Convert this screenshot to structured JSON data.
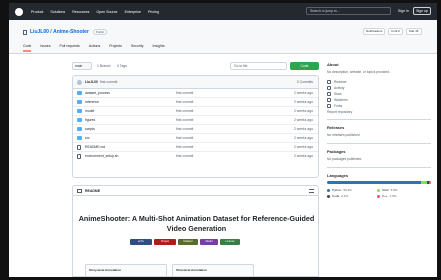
{
  "nav": {
    "items": [
      "Product",
      "Solutions",
      "Resources",
      "Open Source",
      "Enterprise",
      "Pricing"
    ],
    "search_placeholder": "Search or jump to...",
    "signin": "Sign in",
    "signup": "Sign up"
  },
  "repo": {
    "owner": "LiuJL00",
    "name": "Anime-Shooter",
    "visibility": "Public",
    "buttons": [
      "Notifications",
      "Fork 0",
      "Star 45"
    ],
    "tabs": [
      "Code",
      "Issues",
      "Pull requests",
      "Actions",
      "Projects",
      "Security",
      "Insights"
    ]
  },
  "controls": {
    "branch": "main",
    "branches": "1 Branch",
    "tags": "0 Tags",
    "goto": "Go to file",
    "code": "Code"
  },
  "commit": {
    "user": "LiuJL00",
    "message": "first commit",
    "count": "3 Commits"
  },
  "files": [
    {
      "name": "dataset_process",
      "type": "dir",
      "msg": "first commit",
      "time": "2 weeks ago"
    },
    {
      "name": "inference",
      "type": "dir",
      "msg": "first commit",
      "time": "2 weeks ago"
    },
    {
      "name": "model",
      "type": "dir",
      "msg": "first commit",
      "time": "2 weeks ago"
    },
    {
      "name": "figures",
      "type": "dir",
      "msg": "first commit",
      "time": "2 weeks ago"
    },
    {
      "name": "scripts",
      "type": "dir",
      "msg": "first commit",
      "time": "2 weeks ago"
    },
    {
      "name": "src",
      "type": "dir",
      "msg": "first commit",
      "time": "2 weeks ago"
    },
    {
      "name": "README.md",
      "type": "file",
      "msg": "first commit",
      "time": "2 weeks ago"
    },
    {
      "name": "environment_setup.sh",
      "type": "file",
      "msg": "first commit",
      "time": "2 weeks ago"
    }
  ],
  "readme": {
    "label": "README",
    "title": "AnimeShooter: A Multi-Shot Animation Dataset for Reference-Guided Video Generation",
    "badges": [
      {
        "text": "arXiv",
        "color": "#2f4f7f"
      },
      {
        "text": "Project",
        "color": "#b31b1b"
      },
      {
        "text": "Dataset",
        "color": "#5a6b2f"
      },
      {
        "text": "Model",
        "color": "#7a3e9d"
      },
      {
        "text": "License",
        "color": "#3a7d44"
      }
    ],
    "fig_left": "Story-level Annotation",
    "fig_right": "Shot-level Annotation"
  },
  "sidebar": {
    "about_title": "About",
    "about_desc": "No description, website, or topics provided.",
    "links": [
      "Readme",
      "Activity",
      "Stars",
      "Watchers",
      "Forks"
    ],
    "report": "Report repository",
    "releases_title": "Releases",
    "releases_text": "No releases published",
    "packages_title": "Packages",
    "packages_text": "No packages published",
    "languages_title": "Languages",
    "languages": [
      {
        "name": "Python",
        "pct": "90.3%",
        "color": "#3572A5",
        "value": 90.3
      },
      {
        "name": "Shell",
        "pct": "5.8%",
        "color": "#89e051",
        "value": 5.8
      },
      {
        "name": "Cuda",
        "pct": "2.4%",
        "color": "#3A4E3A",
        "value": 2.4
      },
      {
        "name": "C++",
        "pct": "1.5%",
        "color": "#f34b7d",
        "value": 1.5
      }
    ]
  }
}
